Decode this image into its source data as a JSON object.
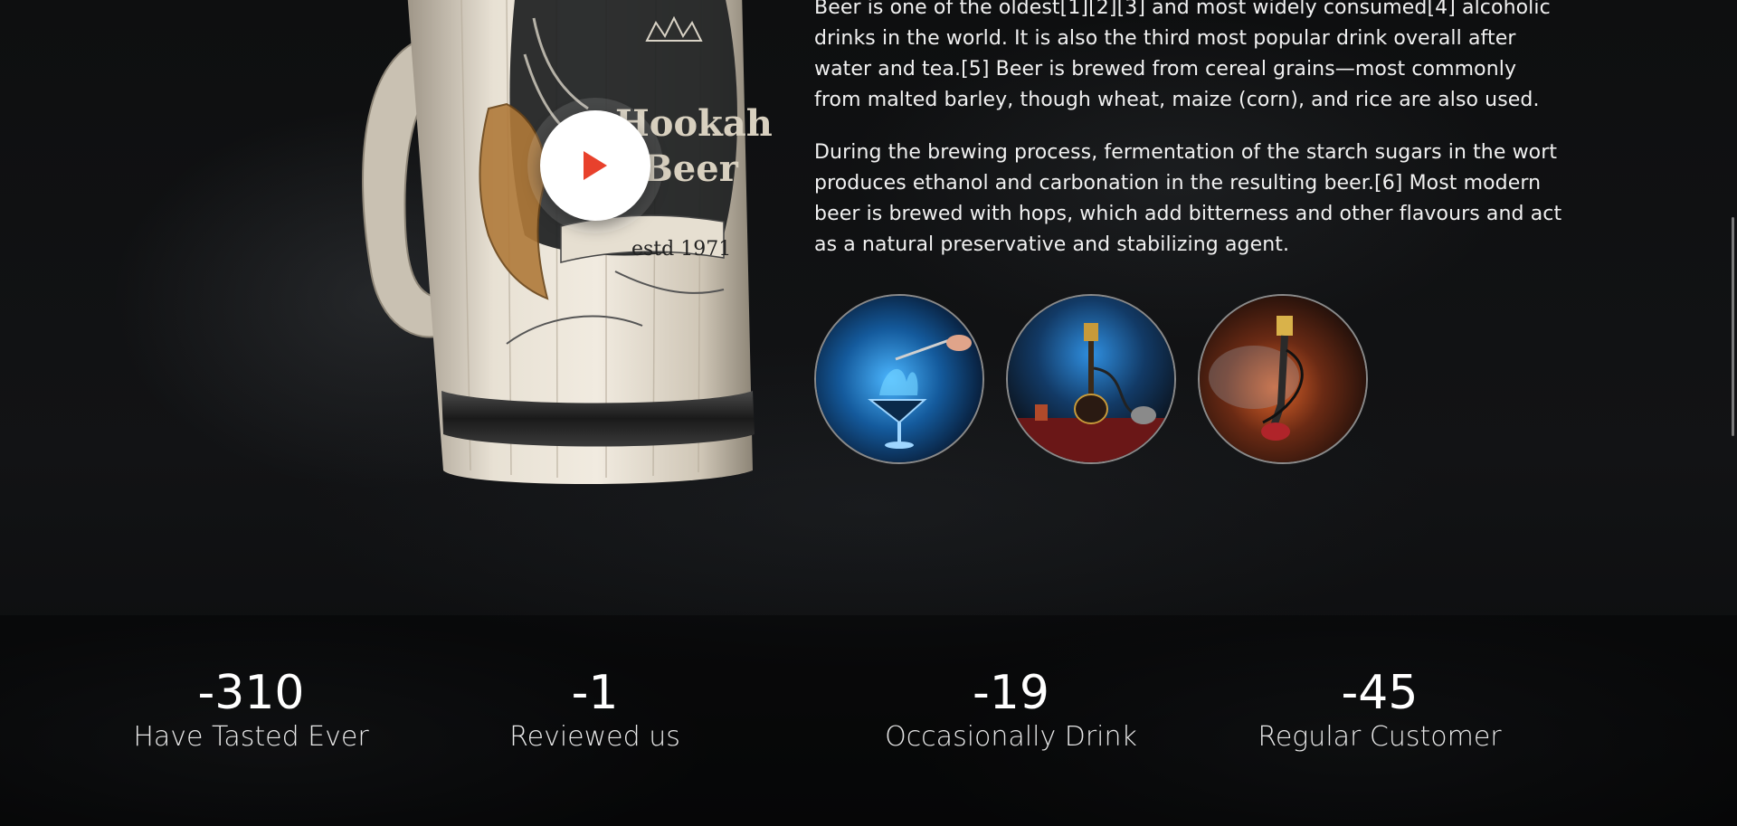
{
  "video": {
    "play_label": "Play video"
  },
  "about": {
    "paragraph1": "Beer is one of the oldest[1][2][3] and most widely consumed[4] alcoholic drinks in the world. It is also the third most popular drink overall after water and tea.[5] Beer is brewed from cereal grains—most commonly from malted barley, though wheat, maize (corn), and rice are also used.",
    "paragraph2": "During the brewing process, fermentation of the starch sugars in the wort produces ethanol and carbonation in the resulting beer.[6] Most modern beer is brewed with hops, which add bitterness and other flavours and act as a natural preservative and stabilizing agent."
  },
  "mug": {
    "brand_line1": "Hookah",
    "brand_line2": "Beer",
    "established": "estd 1971"
  },
  "gallery": [
    {
      "icon": "cocktail-photo"
    },
    {
      "icon": "hookah-photo"
    },
    {
      "icon": "hookah-smoke-photo"
    }
  ],
  "stats": [
    {
      "number": "-310",
      "label": "Have Tasted Ever"
    },
    {
      "number": "-1",
      "label": "Reviewed us"
    },
    {
      "number": "-19",
      "label": "Occasionally Drink"
    },
    {
      "number": "-45",
      "label": "Regular Customer"
    }
  ],
  "colors": {
    "background": "#0b0c0d",
    "play_accent": "#e8412c",
    "text": "#f1f1f1"
  }
}
